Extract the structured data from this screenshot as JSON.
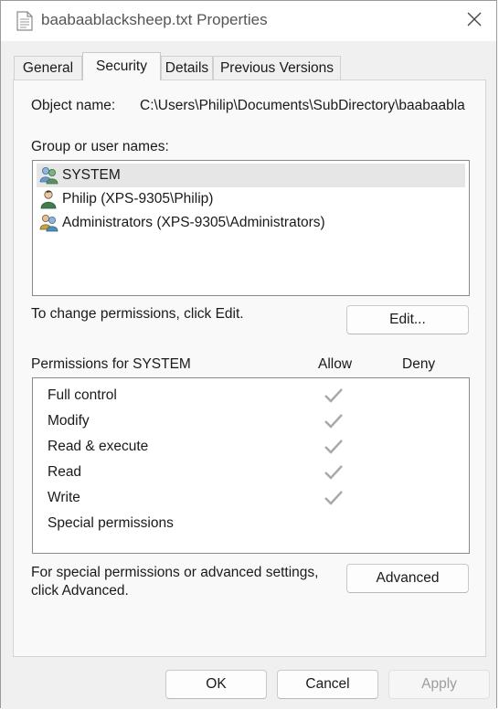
{
  "window": {
    "title": "baabaablacksheep.txt Properties",
    "file_icon": "text-file-icon",
    "close_icon": "close-icon"
  },
  "tabs": [
    {
      "label": "General",
      "active": false
    },
    {
      "label": "Security",
      "active": true
    },
    {
      "label": "Details",
      "active": false
    },
    {
      "label": "Previous Versions",
      "active": false
    }
  ],
  "security": {
    "object_name_label": "Object name:",
    "object_name_value": "C:\\Users\\Philip\\Documents\\SubDirectory\\baabaabla",
    "group_label": "Group or user names:",
    "users": [
      {
        "name": "SYSTEM",
        "icon": "user-group-icon",
        "selected": true
      },
      {
        "name": "Philip (XPS-9305\\Philip)",
        "icon": "user-icon",
        "selected": false
      },
      {
        "name": "Administrators (XPS-9305\\Administrators)",
        "icon": "admin-group-icon",
        "selected": false
      }
    ],
    "change_text": "To change permissions, click Edit.",
    "edit_button": "Edit...",
    "permissions_for": "Permissions for SYSTEM",
    "allow_header": "Allow",
    "deny_header": "Deny",
    "permissions": [
      {
        "name": "Full control",
        "allow": true,
        "deny": false
      },
      {
        "name": "Modify",
        "allow": true,
        "deny": false
      },
      {
        "name": "Read & execute",
        "allow": true,
        "deny": false
      },
      {
        "name": "Read",
        "allow": true,
        "deny": false
      },
      {
        "name": "Write",
        "allow": true,
        "deny": false
      },
      {
        "name": "Special permissions",
        "allow": false,
        "deny": false
      }
    ],
    "advanced_text_line1": "For special permissions or advanced settings,",
    "advanced_text_line2": "click Advanced.",
    "advanced_button": "Advanced"
  },
  "footer": {
    "ok": "OK",
    "cancel": "Cancel",
    "apply": "Apply",
    "apply_enabled": false
  },
  "colors": {
    "checkmark": "#a8a8a8",
    "selection": "#e6e6e6"
  }
}
